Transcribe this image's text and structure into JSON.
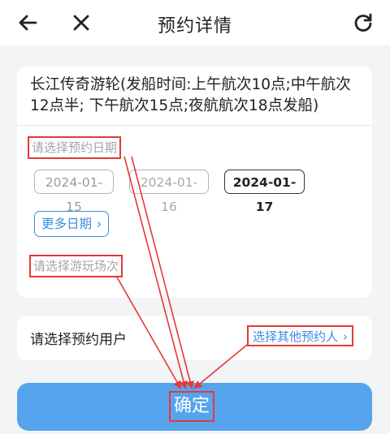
{
  "header": {
    "title": "预约详情",
    "back_icon": "back-arrow-icon",
    "close_icon": "close-icon",
    "refresh_icon": "refresh-icon"
  },
  "booking": {
    "boat_title": "长江传奇游轮(发船时间:上午航次10点;中午航次12点半; 下午航次15点;夜航航次18点发船)",
    "date_hint": "请选择预约日期",
    "dates": [
      "2024-01-15",
      "2024-01-16",
      "2024-01-17"
    ],
    "selected_date": "2024-01-17",
    "more_dates": "更多日期",
    "session_hint": "请选择游玩场次"
  },
  "user": {
    "label": "请选择预约用户",
    "other_user": "选择其他预约人"
  },
  "confirm": {
    "label": "确定"
  },
  "colors": {
    "accent": "#3d8be0",
    "button": "#57a4ee",
    "annotation": "#e53935",
    "background": "#f2f4f6"
  }
}
